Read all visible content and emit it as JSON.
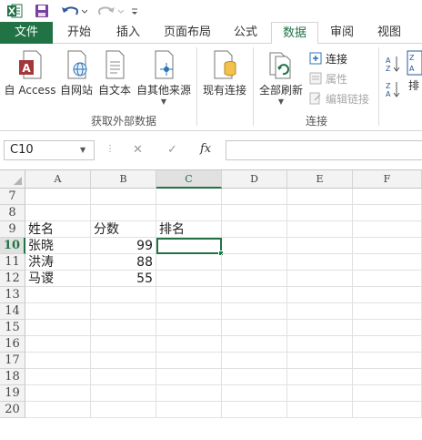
{
  "quick_access": {
    "icons": [
      "excel-icon",
      "save-icon",
      "undo-icon",
      "redo-icon",
      "customize-icon"
    ]
  },
  "tabs": [
    "文件",
    "开始",
    "插入",
    "页面布局",
    "公式",
    "数据",
    "审阅",
    "视图"
  ],
  "active_tab": "数据",
  "ribbon": {
    "external_data": {
      "group_label": "获取外部数据",
      "from_access": "自 Access",
      "from_web": "自网站",
      "from_text": "自文本",
      "from_other": "自其他来源"
    },
    "existing_connections": "现有连接",
    "connections": {
      "group_label": "连接",
      "refresh_all": "全部刷新",
      "connections": "连接",
      "properties": "属性",
      "edit_links": "编辑链接"
    },
    "sort_partial": "排"
  },
  "formula_bar": {
    "name_box": "C10",
    "fx": "fx",
    "value": ""
  },
  "grid": {
    "columns": [
      "A",
      "B",
      "C",
      "D",
      "E",
      "F"
    ],
    "selected_column": "C",
    "rows": [
      "7",
      "8",
      "9",
      "10",
      "11",
      "12",
      "13",
      "14",
      "15",
      "16",
      "17",
      "18",
      "19",
      "20"
    ],
    "selected_row": "10",
    "active_cell": "C10",
    "cells": {
      "A9": "姓名",
      "B9": "分数",
      "C9": "排名",
      "A10": "张晓",
      "B10": "99",
      "A11": "洪涛",
      "B11": "88",
      "A12": "马谡",
      "B12": "55"
    }
  },
  "colors": {
    "excel_green": "#217346"
  }
}
